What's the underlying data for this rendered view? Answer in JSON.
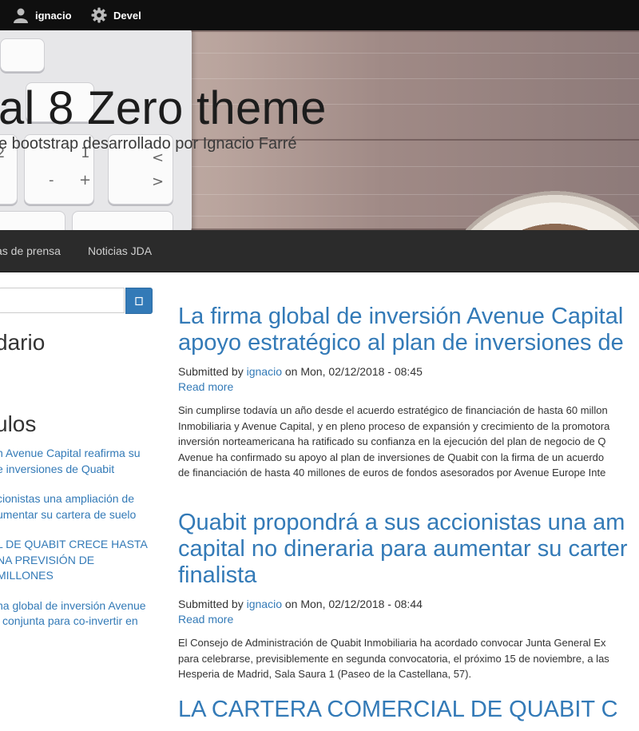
{
  "toolbar": {
    "user_label": "ignacio",
    "devel_label": "Devel"
  },
  "header": {
    "site_name": "al 8 Zero theme",
    "slogan": "e bootstrap desarrollado por Ignacio Farré",
    "keys": [
      "2",
      "1",
      "<",
      "'",
      "-",
      "+",
      ">"
    ]
  },
  "nav": {
    "items": [
      "as de prensa",
      "Noticias JDA"
    ]
  },
  "sidebar": {
    "search": {
      "placeholder": "",
      "button_icon": "search-icon"
    },
    "calendar_title": "dario",
    "articles_title": "ulos",
    "links": [
      "n Avenue Capital reafirma su\ne inversiones de Quabit",
      "cionistas una ampliación de\numentar su cartera de suelo",
      "L DE QUABIT CRECE HASTA\nNA PREVISIÓN DE\nMILLONES",
      "na global de inversión Avenue\nl conjunta para co-invertir en"
    ]
  },
  "articles": [
    {
      "title": "La firma global de inversión Avenue Capital\napoyo estratégico al plan de inversiones de",
      "submitted_by": "Submitted by",
      "author": "ignacio",
      "date": "on Mon, 02/12/2018 - 08:45",
      "read_more": "Read more",
      "body": "Sin cumplirse todavía un año desde el acuerdo estratégico de financiación de hasta 60 millon\nInmobiliaria y Avenue Capital, y en pleno proceso de expansión y crecimiento de la promotora\ninversión norteamericana ha ratificado su confianza en la ejecución del plan de negocio de Q\nAvenue ha confirmado su apoyo al plan de inversiones de Quabit con la firma de un acuerdo\nde financiación de hasta 40 millones de euros de fondos asesorados por Avenue Europe Inte"
    },
    {
      "title": "Quabit propondrá a sus accionistas una am\ncapital no dineraria para aumentar su carter\nfinalista",
      "submitted_by": "Submitted by",
      "author": "ignacio",
      "date": "on Mon, 02/12/2018 - 08:44",
      "read_more": "Read more",
      "body": "El Consejo de Administración de Quabit Inmobiliaria ha acordado convocar Junta General Ex\npara celebrarse, previsiblemente en segunda convocatoria, el próximo 15 de noviembre, a las\nHesperia de Madrid, Sala Saura 1 (Paseo de la Castellana, 57)."
    },
    {
      "title": "LA CARTERA COMERCIAL DE QUABIT C"
    }
  ]
}
